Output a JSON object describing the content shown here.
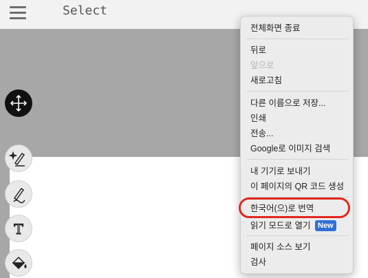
{
  "toolbar": {
    "mode_label": "Select"
  },
  "tools": [
    {
      "name": "move-icon"
    },
    {
      "name": "magic-pen-icon"
    },
    {
      "name": "pen-icon"
    },
    {
      "name": "text-tool-icon"
    },
    {
      "name": "fill-bucket-icon"
    }
  ],
  "context_menu": {
    "items": {
      "exit_fullscreen": "전체화면 종료",
      "back": "뒤로",
      "forward": "앞으로",
      "reload": "새로고침",
      "save_as": "다른 이름으로 저장...",
      "print": "인쇄",
      "cast": "전송...",
      "search_images": "Google로 이미지 검색",
      "send_to_devices": "내 기기로 보내기",
      "qr_code": "이 페이지의 QR 코드 생성",
      "translate": "한국어(으)로 번역",
      "reading_mode": "읽기 모드로 열기",
      "view_source": "페이지 소스 보기",
      "inspect": "검사"
    },
    "new_badge": "New",
    "highlight_color": "#e0261f",
    "badge_color": "#2f6fd6"
  }
}
